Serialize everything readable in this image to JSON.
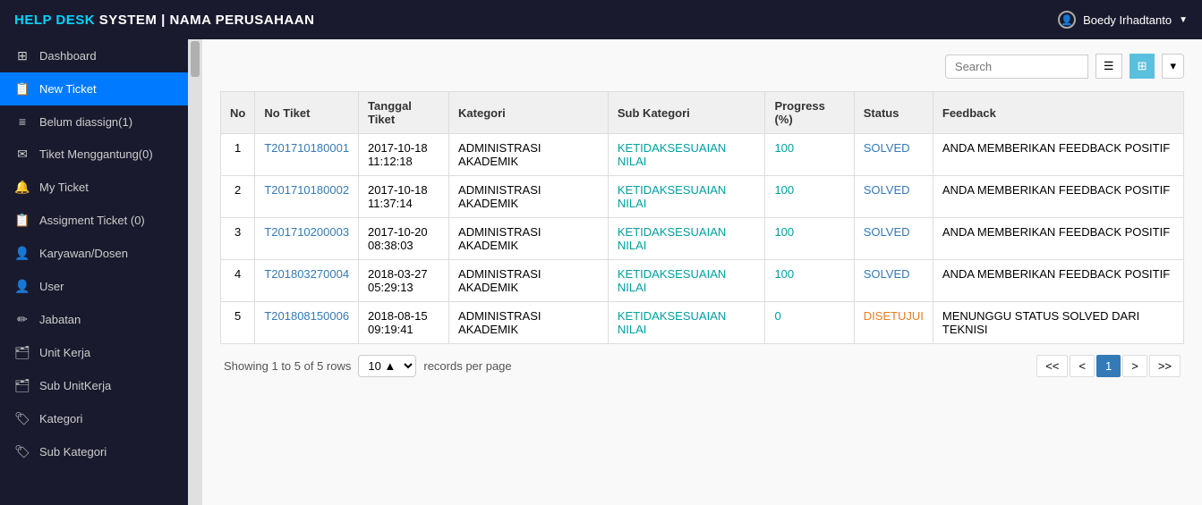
{
  "brand": {
    "help": "HELP DESK",
    "separator": " SYSTEM | ",
    "company": "NAMA PERUSAHAAN"
  },
  "user": {
    "name": "Boedy Irhadtanto",
    "caret": "▼"
  },
  "sidebar": {
    "items": [
      {
        "id": "dashboard",
        "label": "Dashboard",
        "icon": "⊞",
        "active": false
      },
      {
        "id": "new-ticket",
        "label": "New Ticket",
        "icon": "📋",
        "active": true
      },
      {
        "id": "belum-diassign",
        "label": "Belum diassign(1)",
        "icon": "≡",
        "active": false
      },
      {
        "id": "tiket-menggantung",
        "label": "Tiket Menggantung(0)",
        "icon": "✉",
        "active": false
      },
      {
        "id": "my-ticket",
        "label": "My Ticket",
        "icon": "🔔",
        "active": false
      },
      {
        "id": "assigment-ticket",
        "label": "Assigment Ticket (0)",
        "icon": "📋",
        "active": false
      },
      {
        "id": "karyawan-dosen",
        "label": "Karyawan/Dosen",
        "icon": "👤",
        "active": false
      },
      {
        "id": "user",
        "label": "User",
        "icon": "👤",
        "active": false
      },
      {
        "id": "jabatan",
        "label": "Jabatan",
        "icon": "✏",
        "active": false
      },
      {
        "id": "unit-kerja",
        "label": "Unit Kerja",
        "icon": "🗂",
        "active": false
      },
      {
        "id": "sub-unitkerja",
        "label": "Sub UnitKerja",
        "icon": "🗂",
        "active": false
      },
      {
        "id": "kategori",
        "label": "Kategori",
        "icon": "🏷",
        "active": false
      },
      {
        "id": "sub-kategori",
        "label": "Sub Kategori",
        "icon": "🏷",
        "active": false
      }
    ]
  },
  "toolbar": {
    "search_placeholder": "Search",
    "view_list_label": "≡",
    "view_grid_label": "⊞",
    "view_dropdown_label": "▾"
  },
  "table": {
    "columns": [
      "No",
      "No Tiket",
      "Tanggal Tiket",
      "Kategori",
      "Sub Kategori",
      "Progress (%)",
      "Status",
      "Feedback"
    ],
    "rows": [
      {
        "no": "1",
        "no_tiket": "T201710180001",
        "tanggal": "2017-10-18\n11:12:18",
        "kategori": "ADMINISTRASI AKADEMIK",
        "sub_kategori": "KETIDAKSESUAIAN NILAI",
        "progress": "100",
        "status": "SOLVED",
        "feedback": "ANDA MEMBERIKAN FEEDBACK POSITIF"
      },
      {
        "no": "2",
        "no_tiket": "T201710180002",
        "tanggal": "2017-10-18\n11:37:14",
        "kategori": "ADMINISTRASI AKADEMIK",
        "sub_kategori": "KETIDAKSESUAIAN NILAI",
        "progress": "100",
        "status": "SOLVED",
        "feedback": "ANDA MEMBERIKAN FEEDBACK POSITIF"
      },
      {
        "no": "3",
        "no_tiket": "T201710200003",
        "tanggal": "2017-10-20\n08:38:03",
        "kategori": "ADMINISTRASI AKADEMIK",
        "sub_kategori": "KETIDAKSESUAIAN NILAI",
        "progress": "100",
        "status": "SOLVED",
        "feedback": "ANDA MEMBERIKAN FEEDBACK POSITIF"
      },
      {
        "no": "4",
        "no_tiket": "T201803270004",
        "tanggal": "2018-03-27\n05:29:13",
        "kategori": "ADMINISTRASI AKADEMIK",
        "sub_kategori": "KETIDAKSESUAIAN NILAI",
        "progress": "100",
        "status": "SOLVED",
        "feedback": "ANDA MEMBERIKAN FEEDBACK POSITIF"
      },
      {
        "no": "5",
        "no_tiket": "T201808150006",
        "tanggal": "2018-08-15\n09:19:41",
        "kategori": "ADMINISTRASI AKADEMIK",
        "sub_kategori": "KETIDAKSESUAIAN NILAI",
        "progress": "0",
        "status": "DISETUJUI",
        "feedback": "MENUNGGU STATUS SOLVED DARI TEKNISI"
      }
    ]
  },
  "pagination": {
    "showing": "Showing 1 to 5 of 5 rows",
    "per_page": "10",
    "per_page_label": "records per page",
    "current_page": "1",
    "first": "<<",
    "prev": "<",
    "next": ">",
    "last": ">>"
  }
}
